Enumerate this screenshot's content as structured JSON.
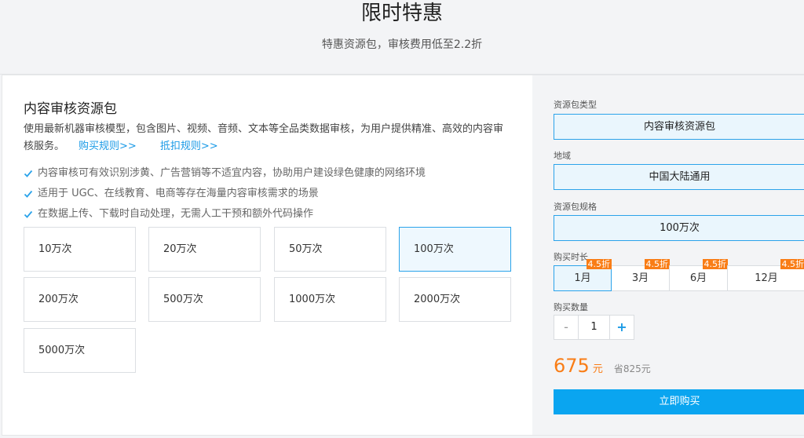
{
  "header": {
    "title": "限时特惠",
    "subtitle": "特惠资源包，审核费用低至2.2折"
  },
  "product": {
    "title": "内容审核资源包",
    "description": "使用最新机器审核模型，包含图片、视频、音频、文本等全品类数据审核，为用户提供精准、高效的内容审核服务。",
    "purchase_rules_link": "购买规则>>",
    "deduction_rules_link": "抵扣规则>>",
    "features": [
      "内容审核可有效识别涉黄、广告营销等不适宜内容，协助用户建设绿色健康的网络环境",
      "适用于 UGC、在线教育、电商等存在海量内容审核需求的场景",
      "在数据上传、下载时自动处理，无需人工干预和额外代码操作"
    ]
  },
  "specs": {
    "options": [
      "10万次",
      "20万次",
      "50万次",
      "100万次",
      "200万次",
      "500万次",
      "1000万次",
      "2000万次",
      "5000万次"
    ],
    "selected": "100万次"
  },
  "order": {
    "type_label": "资源包类型",
    "type_value": "内容审核资源包",
    "region_label": "地域",
    "region_value": "中国大陆通用",
    "spec_label": "资源包规格",
    "spec_value": "100万次",
    "duration_label": "购买时长",
    "durations": [
      {
        "label": "1月",
        "discount": "4.5折"
      },
      {
        "label": "3月",
        "discount": "4.5折"
      },
      {
        "label": "6月",
        "discount": "4.5折"
      },
      {
        "label": "12月",
        "discount": "4.5折"
      }
    ],
    "selected_duration": "1月",
    "quantity_label": "购买数量",
    "quantity": "1",
    "minus": "-",
    "plus": "+",
    "price": "675",
    "price_unit": "元",
    "saved": "省825元",
    "buy_button": "立即购买"
  },
  "colors": {
    "accent": "#0aa5f0",
    "price": "#f97d16",
    "selected_bg": "#eaf6fd"
  }
}
